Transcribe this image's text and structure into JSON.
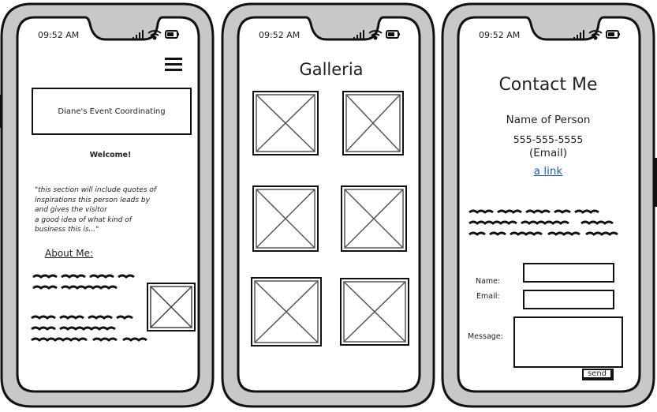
{
  "status": {
    "time": "09:52 AM"
  },
  "phone1": {
    "brand": "Diane's Event Coordinating",
    "welcome": "Welcome!",
    "quote_lines": [
      "\"this section will include quotes of",
      "inspirations this person leads by",
      "and gives the visitor",
      "a good idea of what kind of",
      "business this is...\""
    ],
    "about_heading": "About Me:"
  },
  "phone2": {
    "title": "Galleria"
  },
  "phone3": {
    "title": "Contact Me",
    "name": "Name of Person",
    "phone": "555-555-5555",
    "email": "(Email)",
    "link": "a link",
    "form": {
      "name_label": "Name:",
      "email_label": "Email:",
      "message_label": "Message:",
      "send_label": "send"
    }
  },
  "icons": [
    "menu-icon",
    "signal-icon",
    "wifi-icon",
    "battery-icon",
    "image-placeholder-icon"
  ],
  "colors": {
    "frame": "#c8c8c8",
    "outline": "#111111",
    "link": "#1a5fb4"
  }
}
